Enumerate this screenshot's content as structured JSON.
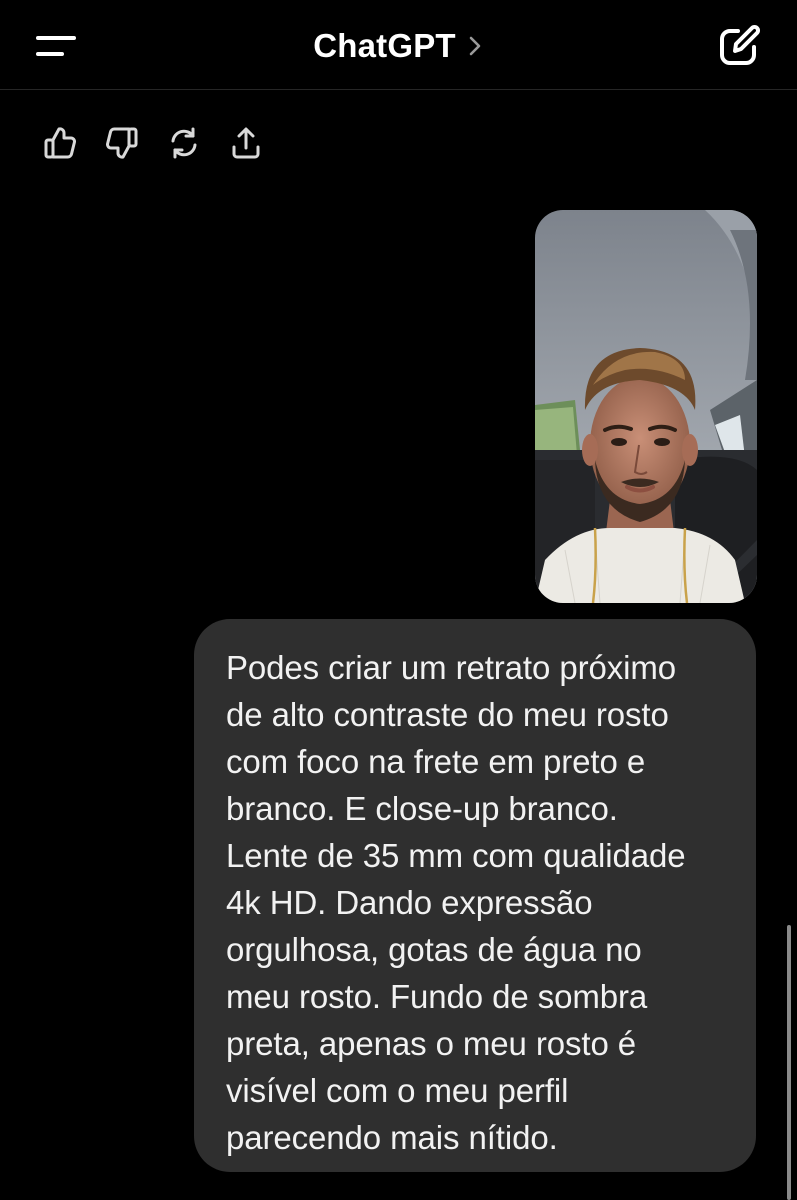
{
  "header": {
    "title": "ChatGPT",
    "icons": {
      "menu": "menu-icon",
      "chevron": "chevron-right-icon",
      "compose": "new-chat-icon"
    }
  },
  "message_actions": [
    {
      "icon": "thumbs-up-icon"
    },
    {
      "icon": "thumbs-down-icon"
    },
    {
      "icon": "regenerate-icon"
    },
    {
      "icon": "share-icon"
    }
  ],
  "user_message": {
    "attachment": "selfie photo",
    "lines": [
      "Podes criar um retrato próximo",
      "de alto contraste do meu rosto",
      "com foco na frete em preto e",
      "branco. E close-up branco.",
      "Lente de 35 mm com qualidade",
      "4k HD. Dando expressão",
      "orgulhosa, gotas de água no",
      "meu rosto. Fundo de sombra",
      "preta, apenas o meu rosto é",
      "visível com o meu perfil",
      "parecendo mais nítido."
    ]
  },
  "colors": {
    "background": "#000000",
    "bubble": "#2f2f2f",
    "text": "#f2f2f2",
    "icon": "#d9d9d9"
  }
}
